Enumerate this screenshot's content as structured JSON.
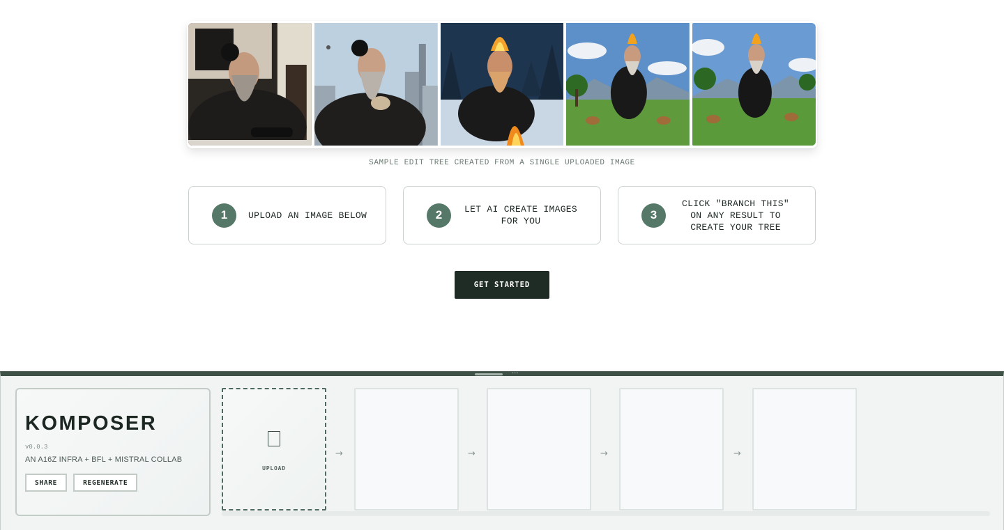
{
  "gallery": {
    "images": [
      {
        "name": "bearded-man-at-computer-photo"
      },
      {
        "name": "bearded-man-in-city-photo"
      },
      {
        "name": "bearded-man-campfire-snow-photo"
      },
      {
        "name": "bearded-man-meadow-deer-photo"
      },
      {
        "name": "bearded-man-dancing-deer-photo"
      }
    ],
    "caption": "SAMPLE EDIT TREE CREATED FROM A SINGLE UPLOADED IMAGE"
  },
  "steps": [
    {
      "number": "1",
      "text": "UPLOAD AN IMAGE BELOW"
    },
    {
      "number": "2",
      "text": "LET AI CREATE IMAGES\nFOR YOU"
    },
    {
      "number": "3",
      "text": "CLICK \"BRANCH THIS\"\nON ANY RESULT TO\nCREATE YOUR TREE"
    }
  ],
  "cta": {
    "label": "GET STARTED"
  },
  "panel": {
    "title": "KOMPOSER",
    "version": "v0.0.3",
    "tagline": "AN A16Z INFRA + BFL + MISTRAL COLLAB",
    "share_label": "SHARE",
    "regenerate_label": "REGENERATE",
    "upload_label": "UPLOAD",
    "arrow": "→",
    "handle_dots": "···",
    "accent_color": "#3e5248"
  }
}
